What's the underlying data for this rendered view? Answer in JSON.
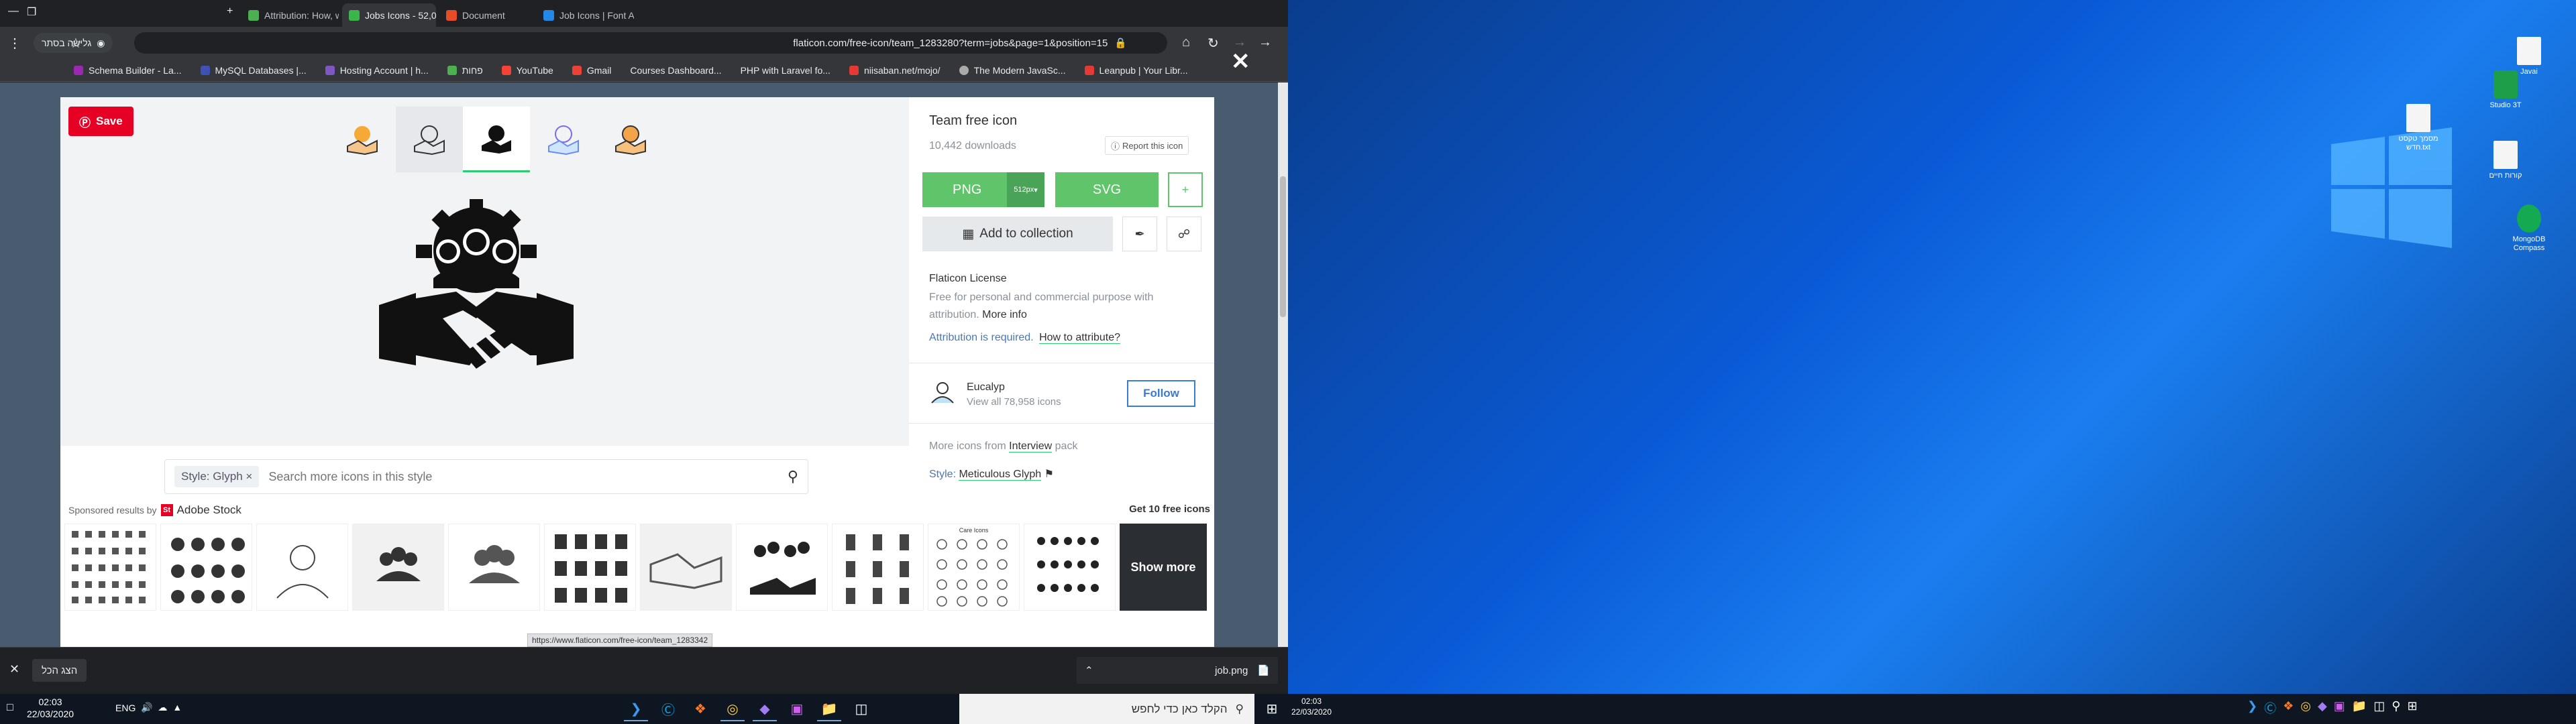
{
  "browser": {
    "tabs": [
      {
        "label": "Attribution: How, when and whe"
      },
      {
        "label": "Jobs Icons - 52,024 free vector ic",
        "active": true
      },
      {
        "label": "Document"
      },
      {
        "label": "Job Icons | Font Awesome"
      }
    ],
    "incognito_label": "גלישה בסתר",
    "url": "flaticon.com/free-icon/team_1283280?term=jobs&page=1&position=15",
    "bookmarks": [
      "Schema Builder - La...",
      "MySQL Databases |...",
      "Hosting Account | h...",
      "פחות",
      "YouTube",
      "Gmail",
      "Courses Dashboard...",
      "PHP with Laravel fo...",
      "niisaban.net/mojo/",
      "The Modern JavaSc...",
      "Leanpub | Your Libr..."
    ]
  },
  "modal": {
    "save_label": "Save",
    "title": "Team free icon",
    "downloads": "10,442 downloads",
    "report_label": "Report this icon",
    "png_label": "PNG",
    "png_size": "512px",
    "svg_label": "SVG",
    "plus_label": "+",
    "collection_label": "Add to collection",
    "license_title": "Flaticon License",
    "license_desc": "Free for personal and commercial purpose with attribution.",
    "more_info": "More info",
    "attr_required": "Attribution is required.",
    "how_to_attr": "How to attribute?",
    "author_name": "Eucalyp",
    "author_count": "View all 78,958 icons",
    "follow_label": "Follow",
    "more_from_prefix": "More icons from",
    "more_from_pack": "Interview",
    "more_from_suffix": "pack",
    "style_prefix": "Style:",
    "style_name": "Meticulous Glyph",
    "search_chip": "Style: Glyph ×",
    "search_placeholder": "Search more icons in this style",
    "sponsored": "Sponsored results by",
    "adobe_stock": "Adobe Stock",
    "get_free": "Get 10 free icons",
    "show_more": "Show more",
    "strip_label": "Care Icons"
  },
  "status_url": "https://www.flaticon.com/free-icon/team_1283342",
  "downloads_bar": {
    "show_all": "הצג הכל",
    "file": "job.png"
  },
  "taskbar": {
    "time": "02:03",
    "date": "22/03/2020",
    "lang": "ENG",
    "search_placeholder": "הקלד כאן כדי לחפש",
    "time2": "02:03",
    "date2": "22/03/2020"
  },
  "desktop_icons": [
    {
      "label": "Javai"
    },
    {
      "label": "Studio 3T"
    },
    {
      "label": "מסמך טקסט חדש.txt"
    },
    {
      "label": "קורות חיים"
    },
    {
      "label": "MongoDB Compass"
    }
  ]
}
